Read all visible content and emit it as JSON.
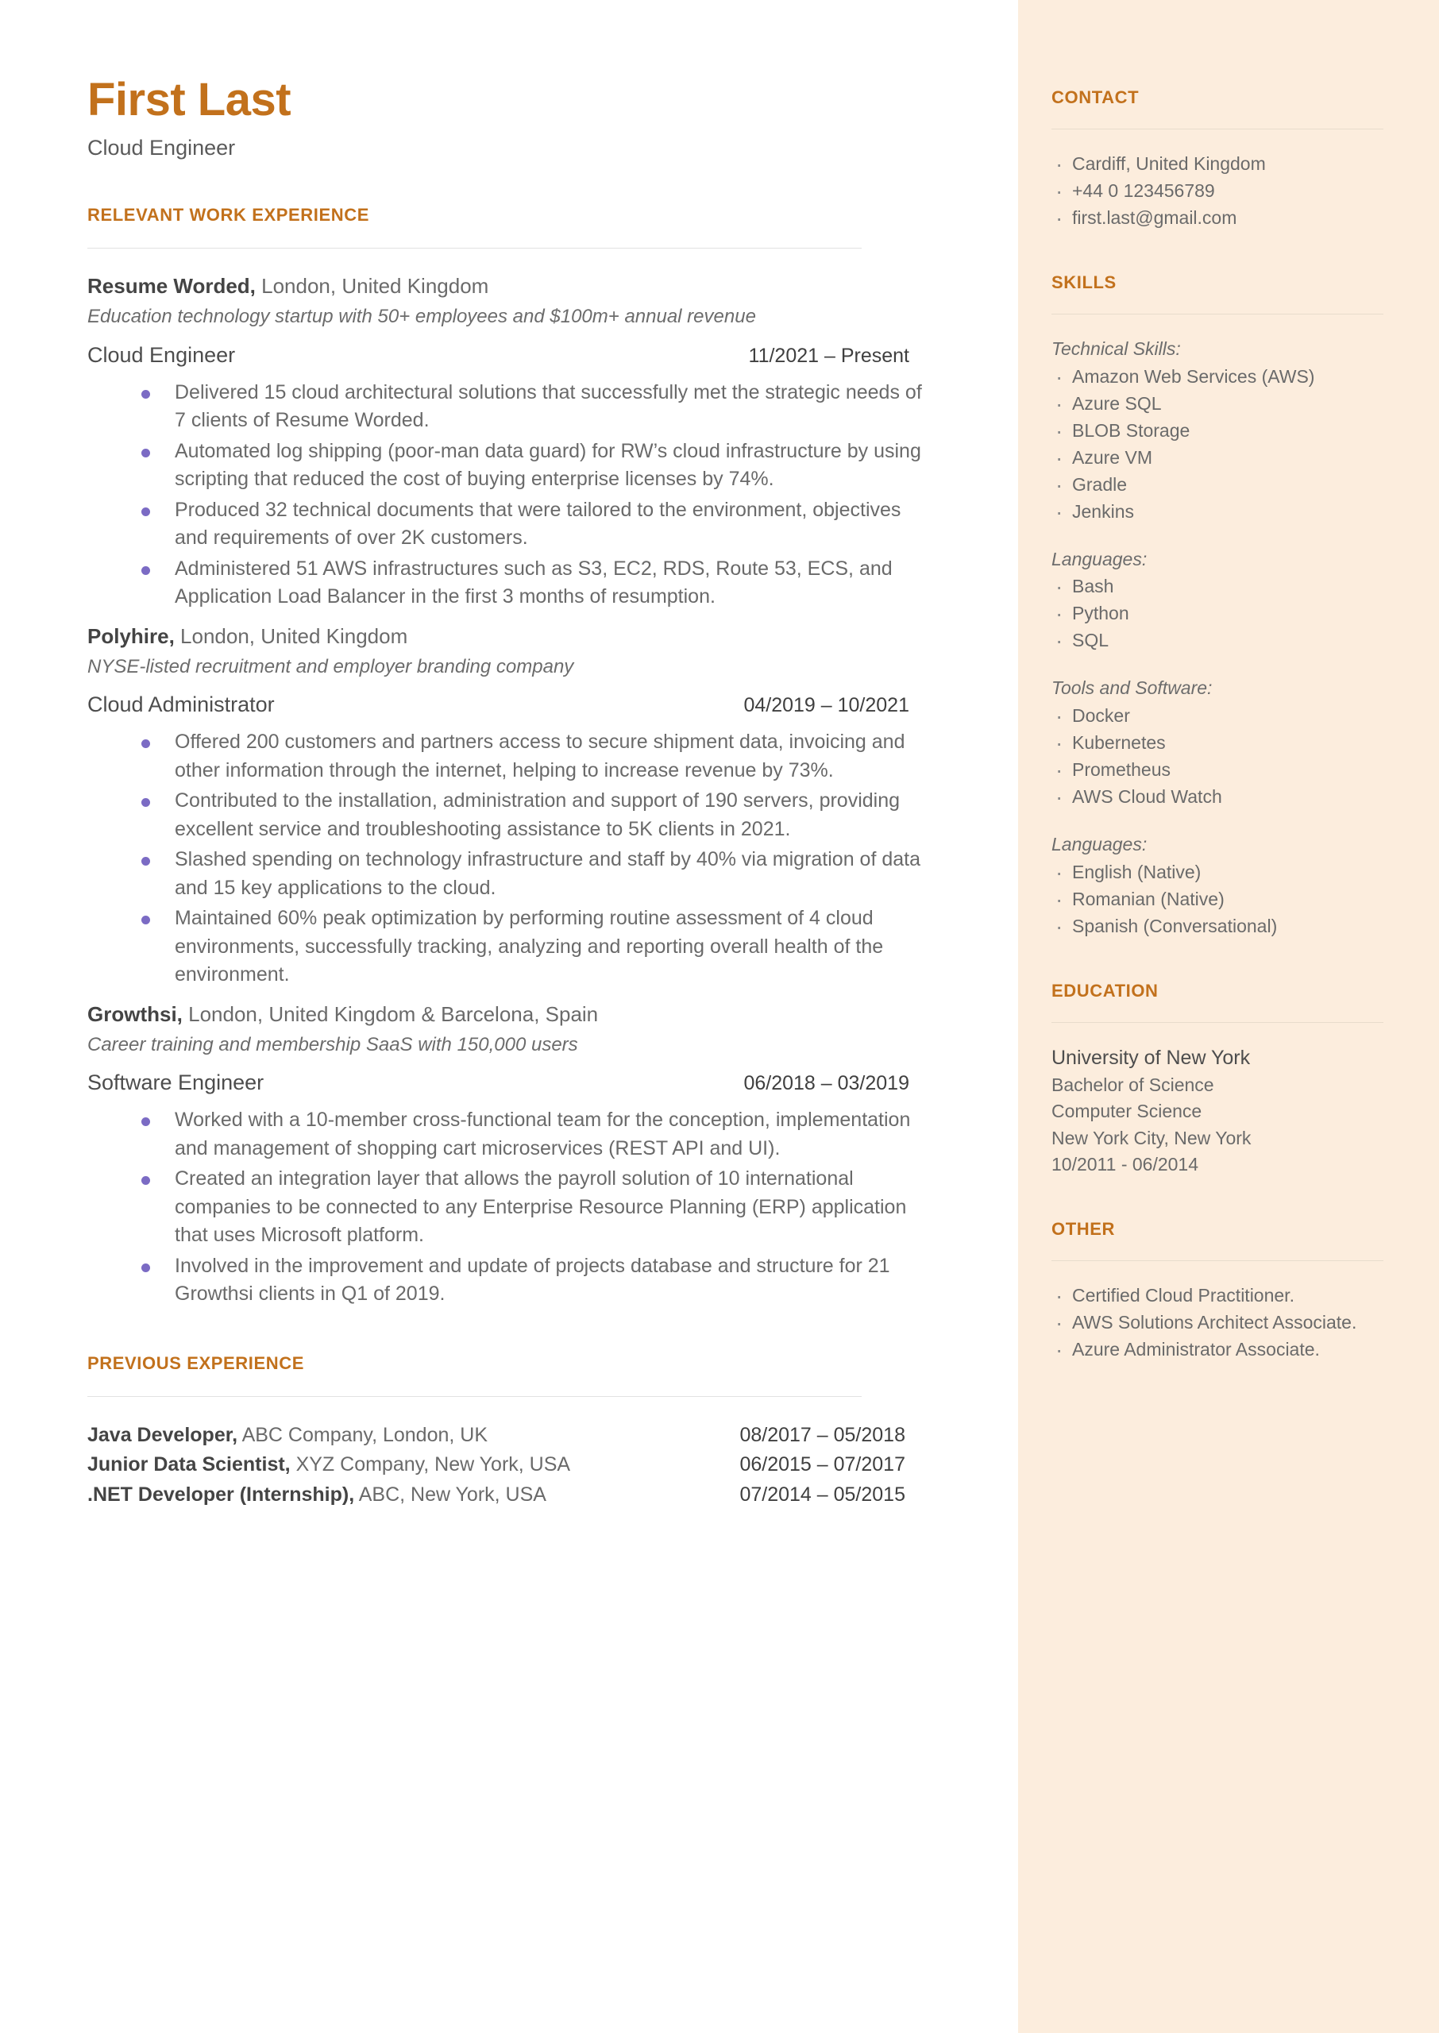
{
  "header": {
    "name": "First Last",
    "headline": "Cloud Engineer"
  },
  "colors": {
    "accent": "#C2711C",
    "sidebar_bg": "#FCEDDD",
    "bullet": "#7B6BC4",
    "body_text": "#6a6a6a"
  },
  "main": {
    "relevant_experience_title": "RELEVANT WORK EXPERIENCE",
    "previous_experience_title": "PREVIOUS EXPERIENCE",
    "jobs": [
      {
        "company": "Resume Worded,",
        "location": " London, United Kingdom",
        "tagline": "Education technology startup with 50+ employees and $100m+ annual revenue",
        "role": "Cloud Engineer",
        "dates": "11/2021 – Present",
        "bullets": [
          "Delivered 15 cloud architectural solutions that successfully met the strategic needs of 7 clients of Resume Worded.",
          "Automated log shipping (poor-man data guard) for RW’s cloud infrastructure by using scripting that reduced the cost of buying enterprise licenses by 74%.",
          "Produced 32 technical documents that were tailored to the environment, objectives and requirements of over 2K customers.",
          "Administered 51 AWS infrastructures such as S3, EC2, RDS, Route 53, ECS, and Application Load Balancer in the first 3 months of resumption."
        ]
      },
      {
        "company": "Polyhire,",
        "location": " London, United Kingdom",
        "tagline": "NYSE-listed recruitment and employer branding company",
        "role": "Cloud Administrator",
        "dates": "04/2019 – 10/2021",
        "bullets": [
          "Offered 200 customers and partners access to secure shipment data, invoicing and other information through the internet, helping to increase revenue by 73%.",
          "Contributed to the installation, administration and support of 190 servers, providing excellent service and troubleshooting assistance to 5K clients in 2021.",
          "Slashed spending on technology infrastructure and staff by 40% via migration of data and 15 key applications to the cloud.",
          "Maintained 60% peak optimization by performing routine assessment of 4 cloud environments, successfully tracking, analyzing and reporting overall health of the environment."
        ]
      },
      {
        "company": "Growthsi,",
        "location": " London, United Kingdom & Barcelona, Spain",
        "tagline": "Career training and membership SaaS with 150,000 users",
        "role": "Software Engineer",
        "dates": "06/2018 – 03/2019",
        "bullets": [
          "Worked with a 10-member cross-functional team for the conception, implementation and management of shopping cart microservices (REST API and UI).",
          "Created an integration layer that allows the payroll solution of 10 international companies to be connected to any Enterprise Resource Planning (ERP) application that uses Microsoft platform.",
          "Involved in the improvement and update of projects database and structure for 21 Growthsi clients in Q1 of 2019."
        ]
      }
    ],
    "previous_jobs": [
      {
        "title": "Java Developer,",
        "company": " ABC Company, London, UK",
        "dates": "08/2017 – 05/2018"
      },
      {
        "title": "Junior Data Scientist,",
        "company": " XYZ Company, New York, USA",
        "dates": "06/2015 – 07/2017"
      },
      {
        "title": ".NET Developer (Internship),",
        "company": " ABC, New York, USA",
        "dates": "07/2014 – 05/2015"
      }
    ]
  },
  "sidebar": {
    "contact": {
      "title": "CONTACT",
      "items": [
        "Cardiff, United Kingdom",
        "+44 0 123456789",
        "first.last@gmail.com"
      ]
    },
    "skills": {
      "title": "SKILLS",
      "groups": [
        {
          "label": "Technical Skills:",
          "items": [
            "Amazon Web Services (AWS)",
            "Azure SQL",
            "BLOB Storage",
            "Azure VM",
            "Gradle",
            "Jenkins"
          ]
        },
        {
          "label": "Languages:",
          "items": [
            "Bash",
            "Python",
            "SQL"
          ]
        },
        {
          "label": "Tools and Software:",
          "items": [
            "Docker",
            "Kubernetes",
            "Prometheus",
            "AWS Cloud Watch"
          ]
        },
        {
          "label": "Languages:",
          "items": [
            "English (Native)",
            "Romanian (Native)",
            "Spanish (Conversational)"
          ]
        }
      ]
    },
    "education": {
      "title": "EDUCATION",
      "school": "University of New York",
      "degree": "Bachelor of Science",
      "field": "Computer Science",
      "location": "New York City, New York",
      "dates": "10/2011 - 06/2014"
    },
    "other": {
      "title": "OTHER",
      "items": [
        "Certified Cloud Practitioner.",
        "AWS Solutions Architect Associate.",
        "Azure Administrator Associate."
      ]
    }
  }
}
